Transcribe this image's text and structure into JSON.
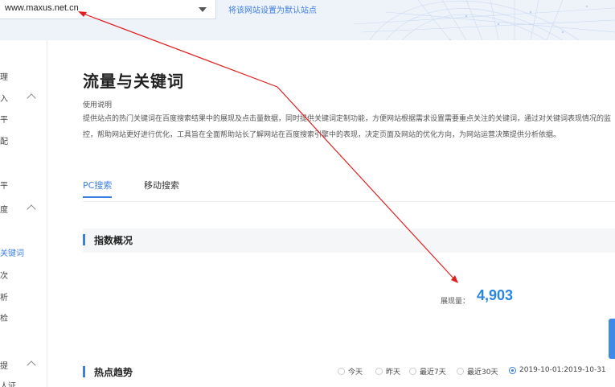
{
  "header": {
    "site_value": "www.maxus.net.cn",
    "set_default_link": "将该网站设置为默认站点"
  },
  "sidebar": {
    "items": [
      {
        "label": "理"
      },
      {
        "label": "入"
      },
      {
        "label": "平"
      },
      {
        "label": "配"
      },
      {
        "label": "平"
      },
      {
        "label": "度"
      },
      {
        "label": "关键词"
      },
      {
        "label": "次"
      },
      {
        "label": "析"
      },
      {
        "label": "检"
      },
      {
        "label": "提"
      },
      {
        "label": "人证"
      }
    ]
  },
  "main": {
    "page_title": "流量与关键词",
    "help_title": "使用说明",
    "help_text": "提供站点的热门关键词在百度搜索结果中的展现及点击量数据，同时提供关键词定制功能，方便网站根据需求设置需要重点关注的关键词，通过对关键词表现情况的监控，帮助网站更好进行优化，工具旨在全面帮助站长了解网站在百度搜索引擎中的表现，决定页面及网站的优化方向，为网站运营决策提供分析依据。",
    "tabs": [
      {
        "label": "PC搜索",
        "active": true
      },
      {
        "label": "移动搜索",
        "active": false
      }
    ],
    "overview": {
      "title": "指数概况",
      "metric_label": "展现量：",
      "metric_value": "4,903"
    },
    "trend": {
      "title": "热点趋势",
      "ranges": [
        {
          "label": "今天",
          "selected": false
        },
        {
          "label": "昨天",
          "selected": false
        },
        {
          "label": "最近7天",
          "selected": false
        },
        {
          "label": "最近30天",
          "selected": false
        },
        {
          "label": "2019-10-01:2019-10-31",
          "selected": true
        }
      ]
    }
  },
  "colors": {
    "accent": "#3d7fe0",
    "metric": "#2a86e4",
    "annotation_arrow": "#e02020"
  }
}
